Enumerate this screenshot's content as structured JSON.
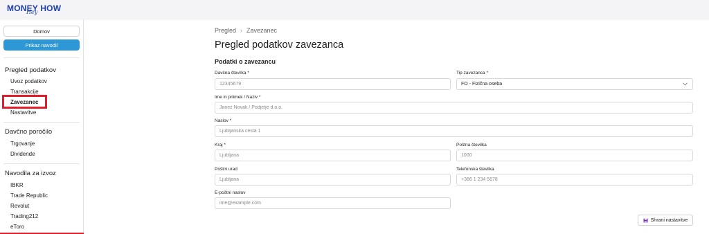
{
  "app": {
    "logo_text": "MONEY HOW",
    "logo_script": "Hey"
  },
  "sidebar": {
    "home_button": "Domov",
    "guide_button": "Prikaz navodil",
    "sections": [
      {
        "title": "Pregled podatkov",
        "items": [
          "Uvoz podatkov",
          "Transakcije",
          "Zavezanec",
          "Nastavitve"
        ]
      },
      {
        "title": "Davčno poročilo",
        "items": [
          "Trgovanje",
          "Dividende"
        ]
      },
      {
        "title": "Navodila za izvoz",
        "items": [
          "IBKR",
          "Trade Republic",
          "Revolut",
          "Trading212",
          "eToro"
        ]
      }
    ],
    "active_item": "Zavezanec"
  },
  "breadcrumb": {
    "root": "Pregled",
    "separator": "›",
    "current": "Zavezanec"
  },
  "page": {
    "title": "Pregled podatkov zavezanca",
    "section_title": "Podatki o zavezancu"
  },
  "form": {
    "tax_number": {
      "label": "Davčna številka *",
      "value": "",
      "placeholder": "12345679"
    },
    "taxpayer_type": {
      "label": "Tip zavezanca *",
      "value": "FO - Fizična oseba"
    },
    "name": {
      "label": "Ime in priimek / Naziv *",
      "value": "",
      "placeholder": "Janez Novak / Podjetje d.o.o."
    },
    "address": {
      "label": "Naslov *",
      "value": "",
      "placeholder": "Ljubljanska cesta 1"
    },
    "city": {
      "label": "Kraj *",
      "value": "",
      "placeholder": "Ljubljana"
    },
    "postal_code": {
      "label": "Poštna številka",
      "value": "",
      "placeholder": "1000"
    },
    "post_office": {
      "label": "Poštni urad",
      "value": "",
      "placeholder": "Ljubljana"
    },
    "phone": {
      "label": "Telefonska številka",
      "value": "",
      "placeholder": "+386 1 234 5678"
    },
    "email": {
      "label": "E-poštni naslov",
      "value": "",
      "placeholder": "ime@example.com"
    }
  },
  "actions": {
    "save_label": "Shrani nastavitve"
  },
  "colors": {
    "brand": "#1f3fa8",
    "primary_button": "#2e97d6",
    "highlight": "#e11d2a",
    "save_icon": "#7a2fb8"
  }
}
